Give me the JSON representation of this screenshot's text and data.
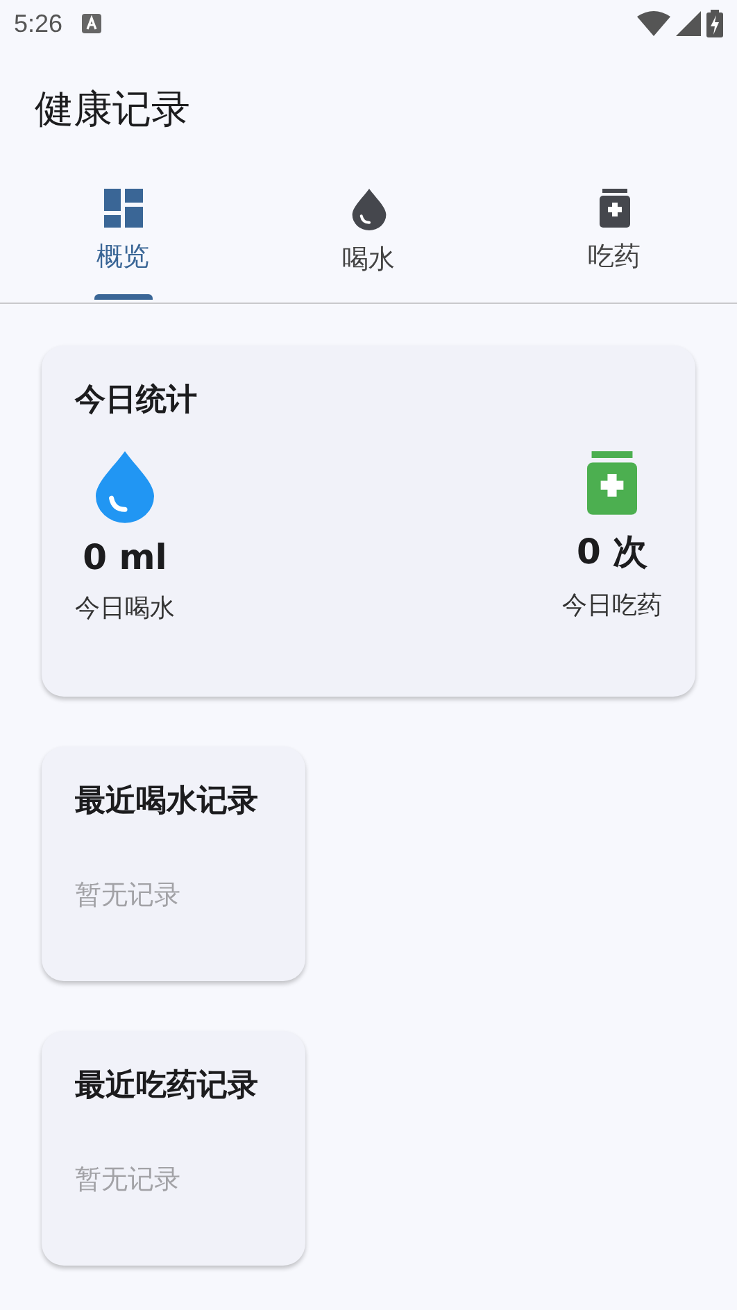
{
  "status_bar": {
    "time": "5:26"
  },
  "app_bar": {
    "title": "健康记录"
  },
  "tabs": [
    {
      "label": "概览",
      "kind": "overview",
      "selected": true
    },
    {
      "label": "喝水",
      "kind": "water",
      "selected": false
    },
    {
      "label": "吃药",
      "kind": "medicine",
      "selected": false
    }
  ],
  "today_card": {
    "title": "今日统计",
    "stats": [
      {
        "kind": "water",
        "color": "#2196f3",
        "value": "0 ml",
        "label": "今日喝水"
      },
      {
        "kind": "medicine",
        "color": "#4caf50",
        "value": "0 次",
        "label": "今日吃药"
      }
    ]
  },
  "recent_cards": [
    {
      "title": "最近喝水记录",
      "empty_text": "暂无记录"
    },
    {
      "title": "最近吃药记录",
      "empty_text": "暂无记录"
    }
  ]
}
